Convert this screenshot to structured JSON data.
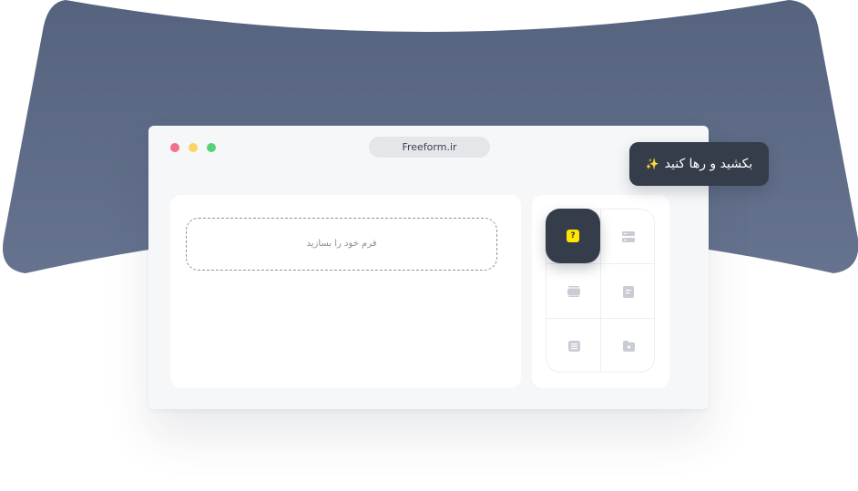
{
  "window": {
    "address_bar": "Freeform.ir",
    "traffic_lights": [
      "close",
      "minimize",
      "maximize"
    ]
  },
  "canvas": {
    "dropzone_label": "فرم خود را بسازید"
  },
  "palette": {
    "items": [
      {
        "icon": "question-icon",
        "label": "?",
        "active": true
      },
      {
        "icon": "list-rows-icon",
        "active": false
      },
      {
        "icon": "card-icon",
        "active": false
      },
      {
        "icon": "document-icon",
        "active": false
      },
      {
        "icon": "text-lines-icon",
        "active": false
      },
      {
        "icon": "folder-icon",
        "active": false
      }
    ]
  },
  "tooltip": {
    "text": "بکشید و رها کنید",
    "emoji": "✨"
  },
  "colors": {
    "backdrop": "#5c6a86",
    "dark": "#353d4b",
    "accent_yellow": "#ffe500",
    "dot_red": "#f2708a",
    "dot_yellow": "#f8d664",
    "dot_green": "#58d278"
  }
}
